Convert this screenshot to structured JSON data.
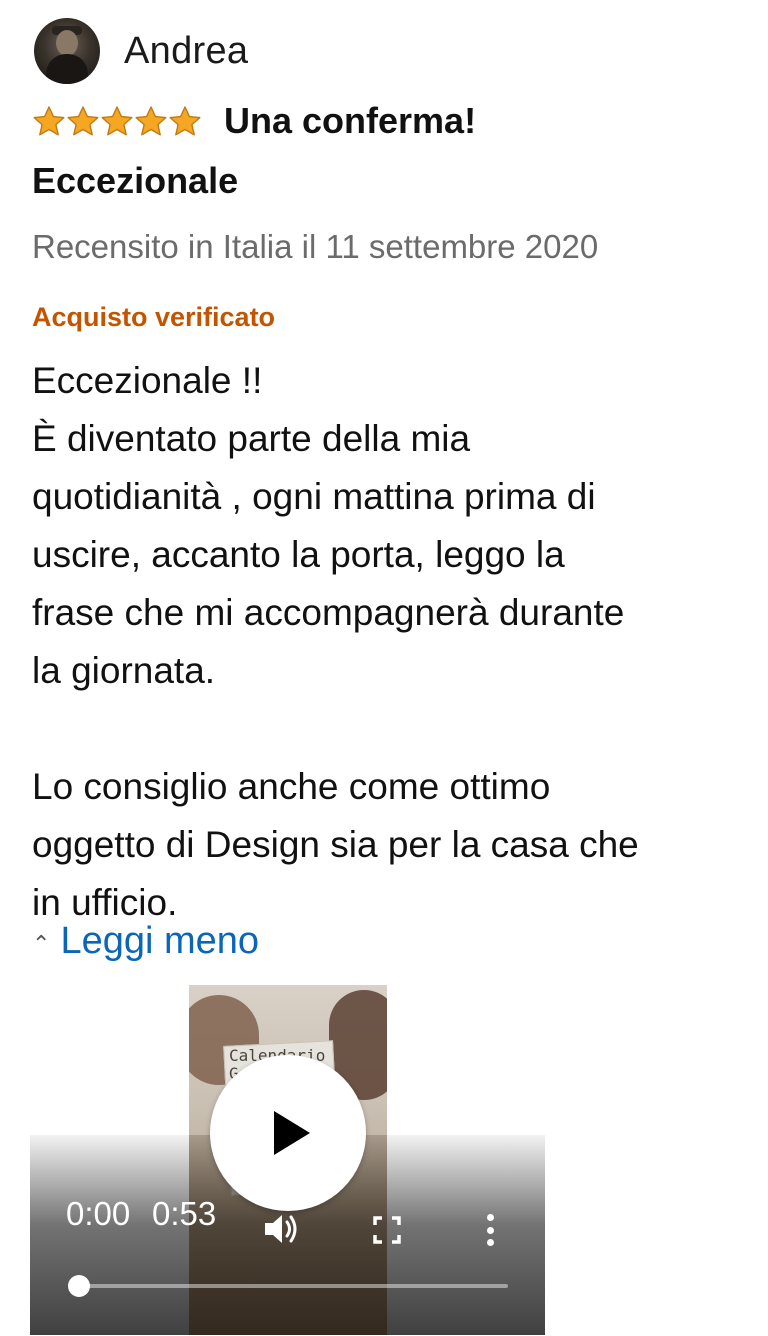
{
  "reviewer": {
    "name": "Andrea",
    "avatar_icon": "user-avatar-photo"
  },
  "rating": {
    "stars": 5,
    "max_stars": 5,
    "star_color": "#f5a623",
    "star_outline": "#c07a12"
  },
  "review": {
    "title_line1": "Una conferma!",
    "title_line2": "Eccezionale",
    "meta": "Recensito in Italia il 11 settembre 2020",
    "verified_label": "Acquisto verificato",
    "verified_color": "#c45500",
    "body_lines": [
      "Eccezionale !!",
      "È diventato parte della mia",
      "quotidianità , ogni mattina prima di",
      "uscire, accanto la porta, leggo la",
      "frase che mi accompagnerà durante",
      "la giornata."
    ],
    "body_lines_2": [
      "Lo consiglio anche come ottimo",
      "oggetto di Design sia per la casa che",
      "in ufficio."
    ],
    "read_less_label": "Leggi meno",
    "link_color": "#0b66b8"
  },
  "video": {
    "current_time": "0:00",
    "total_time": "0:53",
    "progress_fraction": 0.0,
    "frame_card_text": "Calendario\nGeniale",
    "play_icon": "play-icon",
    "volume_icon": "volume-icon",
    "fullscreen_icon": "fullscreen-icon",
    "more_icon": "more-vertical-icon"
  }
}
